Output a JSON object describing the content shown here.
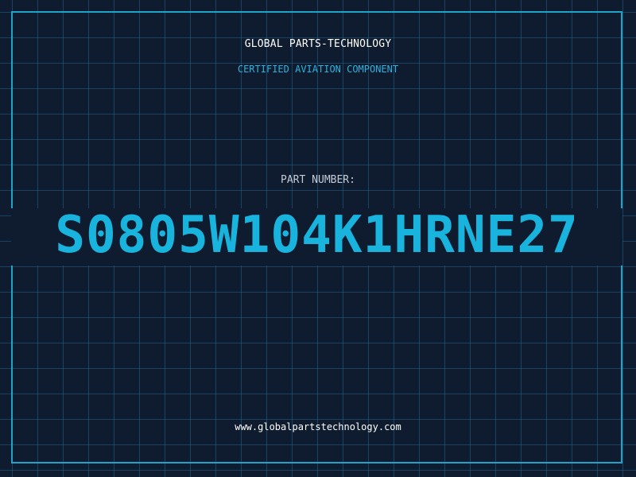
{
  "brand": {
    "name": "GLOBAL PARTS-TECHNOLOGY",
    "tagline": "CERTIFIED AVIATION COMPONENT"
  },
  "part": {
    "label": "PART NUMBER:",
    "number": "S0805W104K1HRNE27"
  },
  "footer": {
    "url": "www.globalpartstechnology.com"
  },
  "colors": {
    "background": "#0f1b2e",
    "grid": "#1e648c",
    "accent": "#19b4dd",
    "border": "#1fa3c9",
    "text": "#ffffff"
  }
}
